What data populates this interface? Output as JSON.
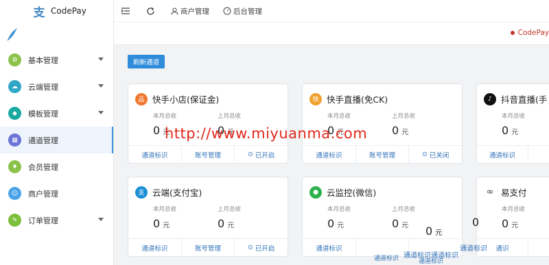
{
  "app": {
    "name": "CodePay",
    "logo_glyph": "支",
    "user_label": "CodePay"
  },
  "header": {
    "nav": [
      {
        "label": "商户管理",
        "icon": "user-icon"
      },
      {
        "label": "后台管理",
        "icon": "dashboard-icon"
      }
    ]
  },
  "sidebar": {
    "items": [
      {
        "label": "基本管理",
        "color": "#8bc34a",
        "arrow": true
      },
      {
        "label": "云端管理",
        "color": "#2fa7c6",
        "arrow": true
      },
      {
        "label": "模板管理",
        "color": "#1aa9a0",
        "arrow": true
      },
      {
        "label": "通道管理",
        "color": "#6b73d6",
        "arrow": false,
        "active": true
      },
      {
        "label": "会员管理",
        "color": "#8bc34a",
        "arrow": false
      },
      {
        "label": "商户管理",
        "color": "#4aa3e8",
        "arrow": false
      },
      {
        "label": "订单管理",
        "color": "#7cbf3b",
        "arrow": true
      }
    ]
  },
  "main": {
    "refresh_label": "刷新通道",
    "month_label": "本月总收",
    "last_month_label": "上月总收",
    "unit": "元",
    "cards": [
      {
        "title": "快手小店(保证金)",
        "this_month": "0",
        "last_month": "0",
        "foot": [
          "通道标识",
          "账号管理",
          "已开启"
        ],
        "color": "#f0782d"
      },
      {
        "title": "快手直播(免CK)",
        "this_month": "0",
        "last_month": "0",
        "foot": [
          "通道标识",
          "账号管理",
          "已关闭"
        ],
        "color": "#f0782d"
      },
      {
        "title": "抖音直播(手",
        "this_month": "0",
        "last_month": "",
        "foot": [
          "通道标识",
          ""
        ],
        "color": "#111111"
      },
      {
        "title": "云端(支付宝)",
        "this_month": "0",
        "last_month": "0",
        "foot": [
          "通道标识",
          "账号管理",
          "已开启"
        ],
        "color": "#1a8fd6"
      },
      {
        "title": "云监控(微信)",
        "this_month": "0",
        "last_month": "0",
        "foot": [
          "通道标识",
          "",
          ""
        ],
        "color": "#2bb24c"
      },
      {
        "title": "易支付",
        "this_month": "0",
        "last_month": "0",
        "foot": [
          "通识",
          ""
        ],
        "color": "#333333"
      }
    ]
  },
  "watermark": "http://www.miyuanma.com",
  "overlay": {
    "stray_zero": "0",
    "stray_unit": "元",
    "stray_link_1": "通道标识",
    "stray_link_2": "通道标识通道标识",
    "stray_link_3": "通道标识",
    "stray_link_4": "通道标识"
  }
}
